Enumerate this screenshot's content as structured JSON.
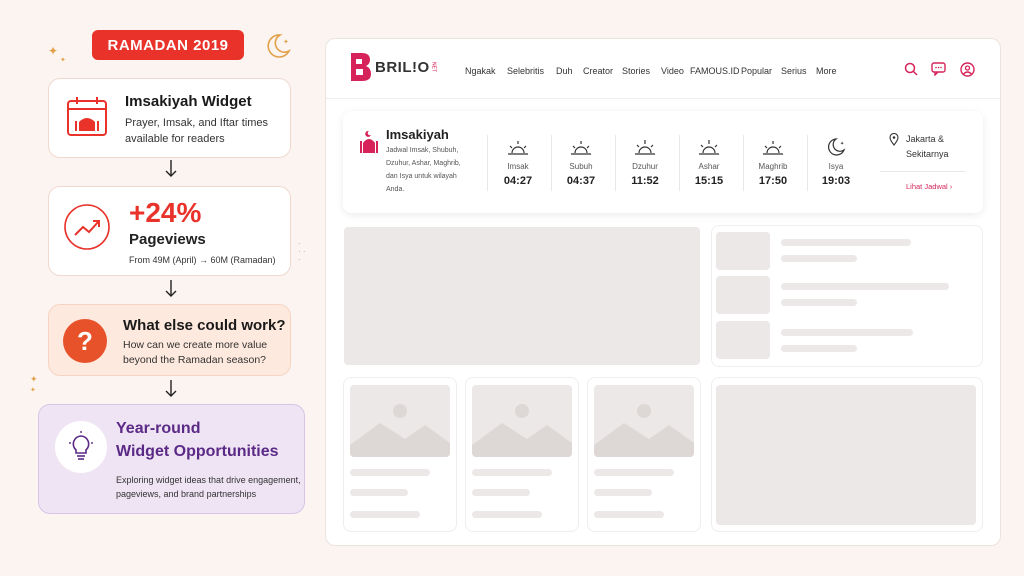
{
  "left": {
    "badge": "RAMADAN 2019",
    "card1": {
      "title": "Imsakiyah Widget",
      "desc_line1": "Prayer, Imsak, and Iftar times",
      "desc_line2": "available for readers"
    },
    "card2": {
      "stat": "+24%",
      "label": "Pageviews",
      "detail": "From 49M (April) → 60M (Ramadan)"
    },
    "card3": {
      "title": "What else could work?",
      "desc_line1": "How can we create more value",
      "desc_line2": "beyond the Ramadan season?"
    },
    "card4": {
      "title_line1": "Year-round",
      "title_line2": "Widget Opportunities",
      "desc_line1": "Exploring widget ideas that drive engagement,",
      "desc_line2": "pageviews, and brand partnerships"
    }
  },
  "browser": {
    "logo": "BRIL!O",
    "logo_suffix": "NET",
    "nav": [
      "Ngakak",
      "Selebritis",
      "Duh",
      "Creator",
      "Stories",
      "Video",
      "FAMOUS.ID",
      "Popular",
      "Serius",
      "More"
    ],
    "widget": {
      "title": "Imsakiyah",
      "desc": [
        "Jadwal Imsak, Shubuh,",
        "Dzuhur, Ashar, Maghrib,",
        "dan Isya untuk wilayah",
        "Anda."
      ],
      "times": [
        {
          "name": "Imsak",
          "time": "04:27",
          "icon": "sunrise-icon"
        },
        {
          "name": "Subuh",
          "time": "04:37",
          "icon": "sunrise-icon"
        },
        {
          "name": "Dzuhur",
          "time": "11:52",
          "icon": "sun-icon"
        },
        {
          "name": "Ashar",
          "time": "15:15",
          "icon": "sun-icon"
        },
        {
          "name": "Maghrib",
          "time": "17:50",
          "icon": "sunset-icon"
        },
        {
          "name": "Isya",
          "time": "19:03",
          "icon": "moon-icon"
        }
      ],
      "location_line1": "Jakarta &",
      "location_line2": "Sekitarnya",
      "schedule_link": "Lihat Jadwal"
    }
  },
  "colors": {
    "accent": "#e8322a",
    "brand": "#d6245a",
    "purple": "#5b2a86"
  }
}
